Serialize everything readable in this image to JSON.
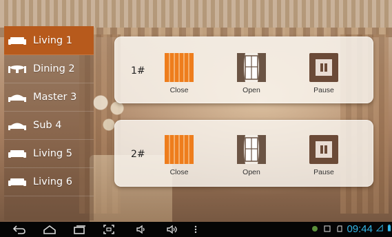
{
  "sidebar": {
    "items": [
      {
        "label": "Living 1",
        "icon": "sofa-icon",
        "active": true
      },
      {
        "label": "Dining 2",
        "icon": "dining-table-icon",
        "active": false
      },
      {
        "label": "Master 3",
        "icon": "bed-icon",
        "active": false
      },
      {
        "label": "Sub 4",
        "icon": "bed-icon",
        "active": false
      },
      {
        "label": "Living 5",
        "icon": "sofa-icon",
        "active": false
      },
      {
        "label": "Living 6",
        "icon": "sofa-icon",
        "active": false
      }
    ]
  },
  "panels": [
    {
      "number": "1#",
      "close_label": "Close",
      "open_label": "Open",
      "pause_label": "Pause"
    },
    {
      "number": "2#",
      "close_label": "Close",
      "open_label": "Open",
      "pause_label": "Pause"
    }
  ],
  "statusbar": {
    "time": "09:44",
    "nav_icons": [
      "back-icon",
      "home-icon",
      "recent-apps-icon",
      "screenshot-icon",
      "volume-down-icon",
      "volume-up-icon",
      "menu-icon"
    ],
    "accent_color": "#33b5e5"
  },
  "colors": {
    "active_item": "#b75a1c",
    "curtain_closed": "#ee7d1c",
    "pause_button": "#6b4a37"
  }
}
